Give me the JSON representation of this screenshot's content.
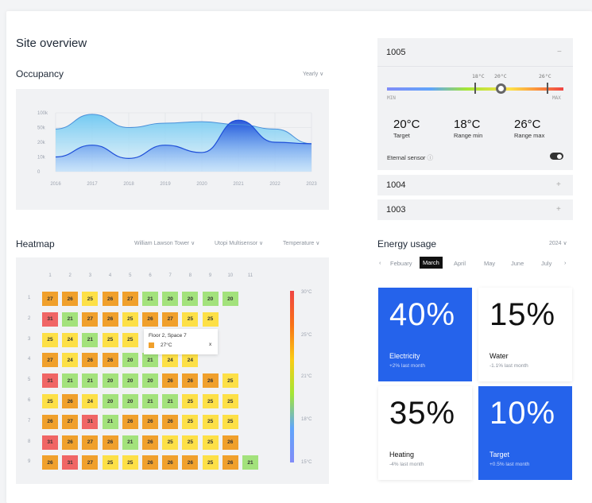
{
  "page_title": "Site overview",
  "occupancy": {
    "title": "Occupancy",
    "period": "Yearly",
    "y_ticks": [
      "100k",
      "50k",
      "20k",
      "10k",
      "0"
    ],
    "x_ticks": [
      "2016",
      "2017",
      "2018",
      "2019",
      "2020",
      "2021",
      "2022",
      "2023"
    ]
  },
  "chart_data": {
    "type": "area",
    "title": "Occupancy",
    "xlabel": "",
    "ylabel": "",
    "x": [
      "2016",
      "2017",
      "2018",
      "2019",
      "2020",
      "2021",
      "2022",
      "2023"
    ],
    "y_ticks": [
      "0",
      "10k",
      "20k",
      "50k",
      "100k"
    ],
    "series": [
      {
        "values": [
          2.9,
          3.9,
          3.0,
          3.3,
          3.4,
          3.2,
          2.9,
          1.9
        ]
      },
      {
        "values": [
          1.0,
          1.8,
          0.9,
          1.8,
          1.3,
          3.5,
          2.0,
          1.9
        ]
      }
    ],
    "grid": true
  },
  "heatmap": {
    "title": "Heatmap",
    "filters": [
      "William Lawson Tower",
      "Utopi Multisensor",
      "Temperature"
    ],
    "cols": [
      "1",
      "2",
      "3",
      "4",
      "5",
      "6",
      "7",
      "8",
      "9",
      "10",
      "11"
    ],
    "rows": [
      "1",
      "2",
      "3",
      "4",
      "5",
      "6",
      "7",
      "8",
      "9"
    ],
    "grid": [
      [
        "27",
        "26",
        "25",
        "26",
        "27",
        "21",
        "20",
        "20",
        "20",
        "20",
        ""
      ],
      [
        "31",
        "21",
        "27",
        "26",
        "25",
        "26",
        "27",
        "25",
        "25",
        "",
        ""
      ],
      [
        "25",
        "24",
        "21",
        "25",
        "25",
        "",
        "",
        "",
        "",
        "",
        ""
      ],
      [
        "27",
        "24",
        "26",
        "26",
        "20",
        "21",
        "24",
        "24",
        "",
        "",
        ""
      ],
      [
        "31",
        "21",
        "21",
        "20",
        "20",
        "20",
        "26",
        "26",
        "26",
        "25",
        ""
      ],
      [
        "25",
        "26",
        "24",
        "20",
        "20",
        "21",
        "21",
        "25",
        "25",
        "25",
        ""
      ],
      [
        "26",
        "27",
        "31",
        "21",
        "26",
        "26",
        "26",
        "25",
        "25",
        "25",
        ""
      ],
      [
        "31",
        "26",
        "27",
        "26",
        "21",
        "26",
        "25",
        "25",
        "25",
        "26",
        ""
      ],
      [
        "26",
        "31",
        "27",
        "25",
        "25",
        "26",
        "26",
        "26",
        "25",
        "26",
        "21"
      ]
    ],
    "scale": [
      "30°C",
      "25°C",
      "21°C",
      "18°C",
      "15°C"
    ],
    "tooltip": {
      "title": "Floor 2, Space 7",
      "value": "27°C",
      "close": "x"
    }
  },
  "sensors": {
    "active": {
      "name": "1005",
      "toggle": "−",
      "marks": [
        "18°C",
        "20°C",
        "26°C"
      ],
      "min": "MIN",
      "max": "MAX",
      "target_value": "20°C",
      "target_label": "Target",
      "rmin_value": "18°C",
      "rmin_label": "Range min",
      "rmax_value": "26°C",
      "rmax_label": "Range max",
      "external_label": "Eternal sensor",
      "info": "ⓘ"
    },
    "collapsed": [
      {
        "name": "1004",
        "toggle": "+"
      },
      {
        "name": "1003",
        "toggle": "+"
      }
    ]
  },
  "energy": {
    "title": "Energy usage",
    "year": "2024",
    "prev": "‹",
    "next": "›",
    "months": [
      "Febuary",
      "March",
      "April",
      "May",
      "June",
      "July"
    ],
    "active_month": "March",
    "cards": [
      {
        "value": "40%",
        "label": "Electricity",
        "sub": "+2% last month"
      },
      {
        "value": "15%",
        "label": "Water",
        "sub": "-1.1% last month"
      },
      {
        "value": "35%",
        "label": "Heating",
        "sub": "-4% last month"
      },
      {
        "value": "10%",
        "label": "Target",
        "sub": "+0.5% last month"
      }
    ]
  },
  "colors": {
    "accent": "#2563eb",
    "heat_red": "#f06565",
    "heat_orange": "#f0a02c",
    "heat_yellow": "#fde047",
    "heat_green": "#a3e27c"
  }
}
